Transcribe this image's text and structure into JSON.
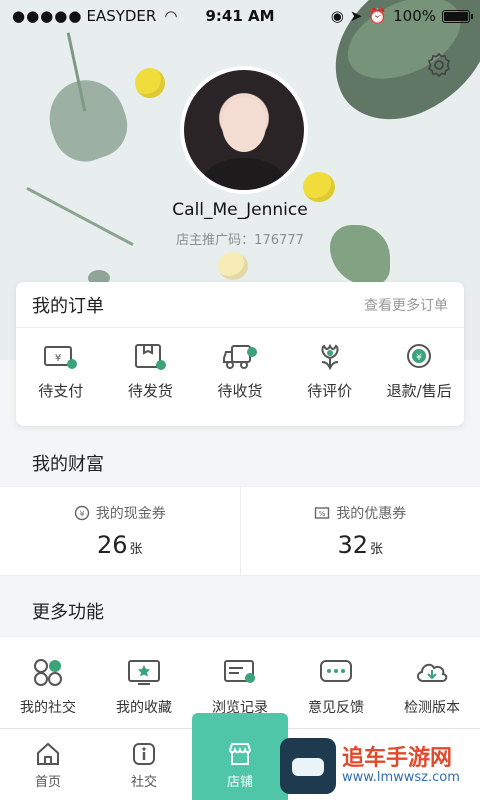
{
  "status_bar": {
    "carrier": "EASYDER",
    "time": "9:41 AM",
    "battery": "100%"
  },
  "profile": {
    "username": "Call_Me_Jennice",
    "promo_code": "店主推广码：176777"
  },
  "orders": {
    "title": "我的订单",
    "more": "查看更多订单",
    "items": [
      {
        "label": "待支付",
        "icon": "wallet-icon"
      },
      {
        "label": "待发货",
        "icon": "package-icon"
      },
      {
        "label": "待收货",
        "icon": "truck-icon"
      },
      {
        "label": "待评价",
        "icon": "flower-icon"
      },
      {
        "label": "退款/售后",
        "icon": "refund-icon"
      }
    ]
  },
  "wealth": {
    "title": "我的财富",
    "cash": {
      "label": "我的现金券",
      "value": "26",
      "unit": "张"
    },
    "coupon": {
      "label": "我的优惠券",
      "value": "32",
      "unit": "张"
    }
  },
  "more_features": {
    "title": "更多功能",
    "items": [
      {
        "label": "我的社交",
        "icon": "social-icon"
      },
      {
        "label": "我的收藏",
        "icon": "favorites-icon"
      },
      {
        "label": "浏览记录",
        "icon": "history-icon"
      },
      {
        "label": "意见反馈",
        "icon": "feedback-icon"
      },
      {
        "label": "检测版本",
        "icon": "cloud-download-icon"
      }
    ]
  },
  "tabbar": {
    "items": [
      {
        "label": "首页",
        "icon": "home-icon"
      },
      {
        "label": "社交",
        "icon": "info-icon"
      },
      {
        "label": "店铺",
        "icon": "shop-icon"
      }
    ]
  },
  "watermark": {
    "text": "追车手游网",
    "url": "www.lmwwsz.com"
  },
  "colors": {
    "accent": "#4fc6a7",
    "icon_green": "#3aa37a"
  }
}
